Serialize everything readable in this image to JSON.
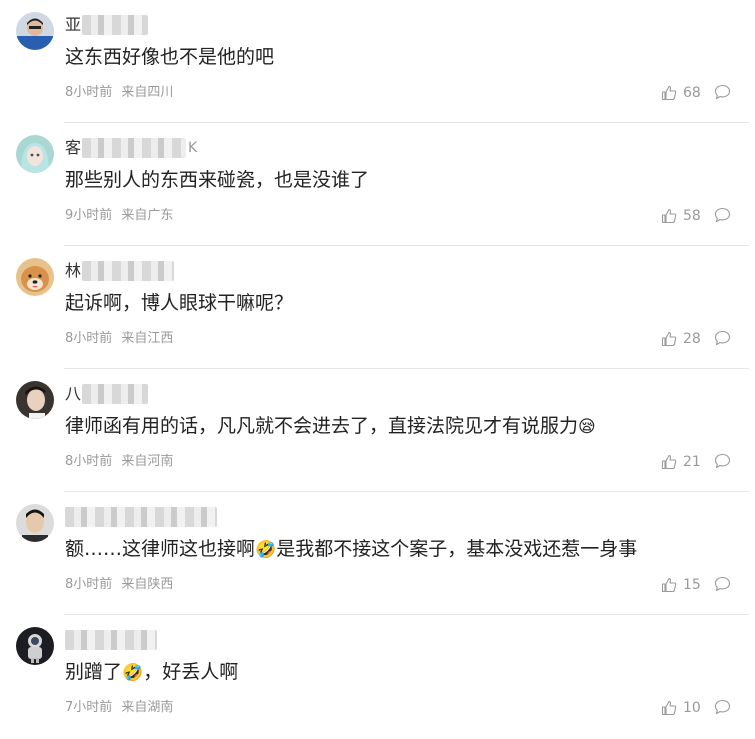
{
  "comments": [
    {
      "name_visible": "亚",
      "name_tail": "",
      "content": "这东西好像也不是他的吧",
      "emoji": "",
      "content_after": "",
      "time": "8小时前",
      "location": "来自四川",
      "likes": "68",
      "avatar": "person-blue-shirt"
    },
    {
      "name_visible": "客",
      "name_tail": "K",
      "content": "那些别人的东西来碰瓷，也是没谁了",
      "emoji": "",
      "content_after": "",
      "time": "9小时前",
      "location": "来自广东",
      "likes": "58",
      "avatar": "anime-girl"
    },
    {
      "name_visible": "林",
      "name_tail": "",
      "content": "起诉啊，博人眼球干嘛呢？",
      "emoji": "",
      "content_after": "",
      "time": "8小时前",
      "location": "来自江西",
      "likes": "28",
      "avatar": "shiba-dog"
    },
    {
      "name_visible": "八",
      "name_tail": "",
      "content": "律师函有用的话，凡凡就不会进去了，直接法院见才有说服力",
      "emoji": "😪",
      "content_after": "",
      "time": "8小时前",
      "location": "来自河南",
      "likes": "21",
      "avatar": "person-dark"
    },
    {
      "name_visible": "",
      "name_tail": "",
      "content": "额……这律师这也接啊",
      "emoji": "🤣",
      "content_after": "是我都不接这个案子，基本没戏还惹一身事",
      "time": "8小时前",
      "location": "来自陕西",
      "likes": "15",
      "avatar": "person-portrait"
    },
    {
      "name_visible": "",
      "name_tail": "",
      "content": "别蹭了",
      "emoji": "🤣",
      "content_after": "，好丢人啊",
      "time": "7小时前",
      "location": "来自湖南",
      "likes": "10",
      "avatar": "astronaut"
    }
  ],
  "colors": {
    "meta_text": "#9a9a9a",
    "content_text": "#222222",
    "divider": "#e6e6e6"
  },
  "icons": {
    "like": "thumbs-up-icon",
    "reply": "speech-bubble-icon"
  }
}
